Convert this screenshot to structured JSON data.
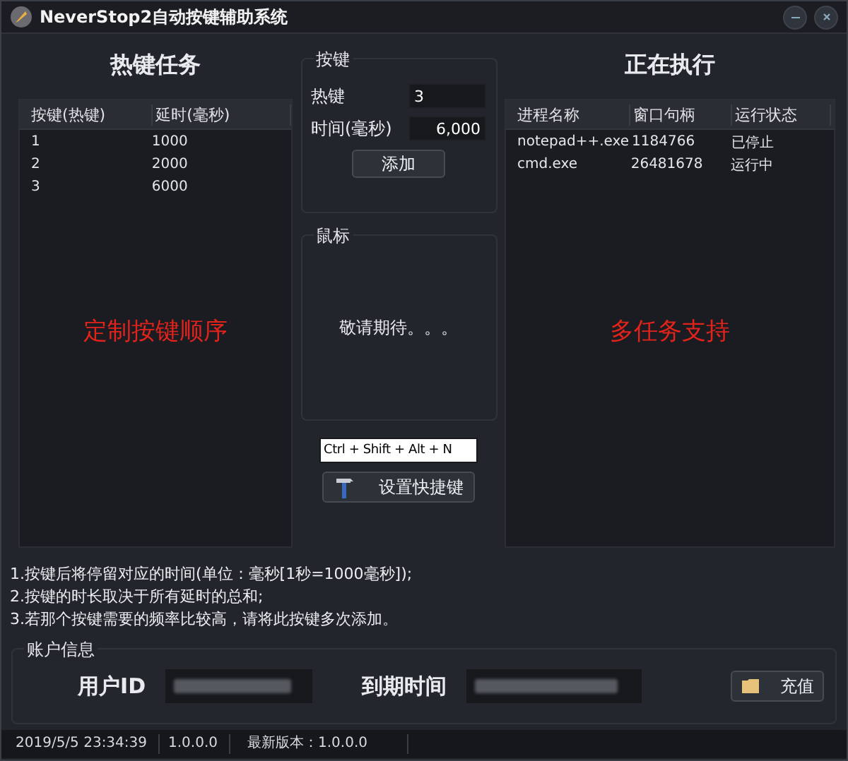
{
  "window": {
    "title": "NeverStop2自动按键辅助系统"
  },
  "hotkey_tasks": {
    "title": "热键任务",
    "columns": [
      "按键(热键)",
      "延时(毫秒)"
    ],
    "rows": [
      [
        "1",
        "1000"
      ],
      [
        "2",
        "2000"
      ],
      [
        "3",
        "6000"
      ]
    ],
    "overlay_text": "定制按键顺序"
  },
  "key_group": {
    "title": "按键",
    "hotkey_label": "热键",
    "hotkey_value": "3",
    "time_label": "时间(毫秒)",
    "time_value": "6,000",
    "add_button": "添加"
  },
  "mouse_group": {
    "title": "鼠标",
    "message": "敬请期待。。。"
  },
  "shortcut": {
    "value": "Ctrl + Shift + Alt + N",
    "button": "设置快捷键"
  },
  "running": {
    "title": "正在执行",
    "columns": [
      "进程名称",
      "窗口句柄",
      "运行状态"
    ],
    "rows": [
      [
        "notepad++.exe",
        "1184766",
        "已停止"
      ],
      [
        "cmd.exe",
        "26481678",
        "运行中"
      ]
    ],
    "overlay_text": "多任务支持"
  },
  "notes": [
    "1.按键后将停留对应的时间(单位：毫秒[1秒=1000毫秒]);",
    "2.按键的时长取决于所有延时的总和;",
    "3.若那个按键需要的频率比较高，请将此按键多次添加。"
  ],
  "account": {
    "title": "账户信息",
    "user_id_label": "用户ID",
    "expiry_label": "到期时间",
    "recharge_button": "充值"
  },
  "status_bar": [
    "2019/5/5 23:34:39",
    "1.0.0.0",
    "最新版本：1.0.0.0"
  ]
}
